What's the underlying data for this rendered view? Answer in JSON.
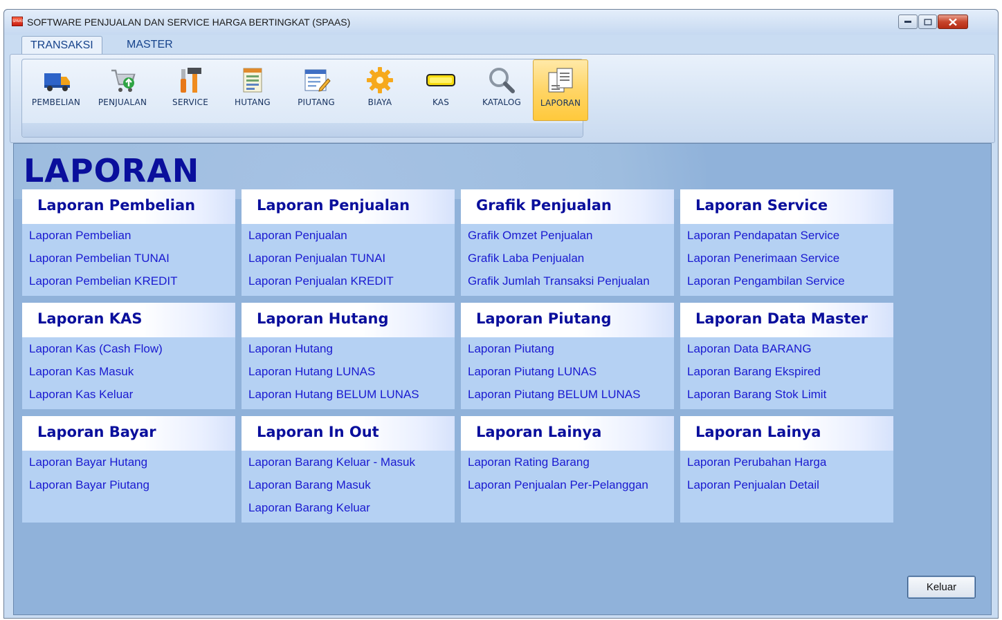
{
  "window": {
    "title": "SOFTWARE PENJUALAN DAN SERVICE HARGA BERTINGKAT (SPAAS)",
    "app_icon_text": "SPAAS"
  },
  "ribbon": {
    "tabs": [
      {
        "label": "TRANSAKSI",
        "active": true
      },
      {
        "label": "MASTER",
        "active": false
      }
    ],
    "buttons": [
      {
        "label": "PEMBELIAN",
        "icon": "delivery-truck-icon"
      },
      {
        "label": "PENJUALAN",
        "icon": "shopping-cart-icon"
      },
      {
        "label": "SERVICE",
        "icon": "tools-icon"
      },
      {
        "label": "HUTANG",
        "icon": "ledger-icon"
      },
      {
        "label": "PIUTANG",
        "icon": "form-pencil-icon"
      },
      {
        "label": "BIAYA",
        "icon": "gear-icon"
      },
      {
        "label": "KAS",
        "icon": "cash-bar-icon"
      },
      {
        "label": "KATALOG",
        "icon": "magnifier-icon"
      },
      {
        "label": "LAPORAN",
        "icon": "documents-icon",
        "selected": true
      }
    ]
  },
  "page": {
    "title": "LAPORAN",
    "sections": [
      {
        "title": "Laporan Pembelian",
        "links": [
          "Laporan Pembelian",
          "Laporan Pembelian TUNAI",
          "Laporan Pembelian KREDIT"
        ]
      },
      {
        "title": "Laporan Penjualan",
        "links": [
          "Laporan Penjualan",
          "Laporan Penjualan TUNAI",
          "Laporan Penjualan KREDIT"
        ]
      },
      {
        "title": "Grafik Penjualan",
        "links": [
          "Grafik Omzet Penjualan",
          "Grafik Laba Penjualan",
          "Grafik Jumlah Transaksi Penjualan"
        ]
      },
      {
        "title": "Laporan Service",
        "links": [
          "Laporan Pendapatan Service",
          "Laporan Penerimaan Service",
          "Laporan Pengambilan Service"
        ]
      },
      {
        "title": "Laporan KAS",
        "links": [
          "Laporan Kas (Cash Flow)",
          "Laporan Kas Masuk",
          "Laporan Kas Keluar"
        ]
      },
      {
        "title": "Laporan Hutang",
        "links": [
          "Laporan Hutang",
          "Laporan Hutang LUNAS",
          "Laporan Hutang BELUM LUNAS"
        ]
      },
      {
        "title": "Laporan Piutang",
        "links": [
          "Laporan Piutang",
          "Laporan Piutang LUNAS",
          "Laporan Piutang BELUM LUNAS"
        ]
      },
      {
        "title": "Laporan Data Master",
        "links": [
          "Laporan Data BARANG",
          "Laporan Barang Ekspired",
          "Laporan Barang Stok Limit"
        ]
      },
      {
        "title": "Laporan Bayar",
        "links": [
          "Laporan Bayar Hutang",
          "Laporan Bayar Piutang"
        ]
      },
      {
        "title": "Laporan In Out",
        "links": [
          "Laporan Barang Keluar - Masuk",
          "Laporan Barang Masuk",
          "Laporan Barang Keluar"
        ]
      },
      {
        "title": "Laporan Lainya",
        "links": [
          "Laporan Rating Barang",
          "Laporan Penjualan Per-Pelanggan"
        ]
      },
      {
        "title": "Laporan Lainya",
        "links": [
          "Laporan Perubahan Harga",
          "Laporan Penjualan Detail"
        ]
      }
    ],
    "exit_label": "Keluar"
  }
}
